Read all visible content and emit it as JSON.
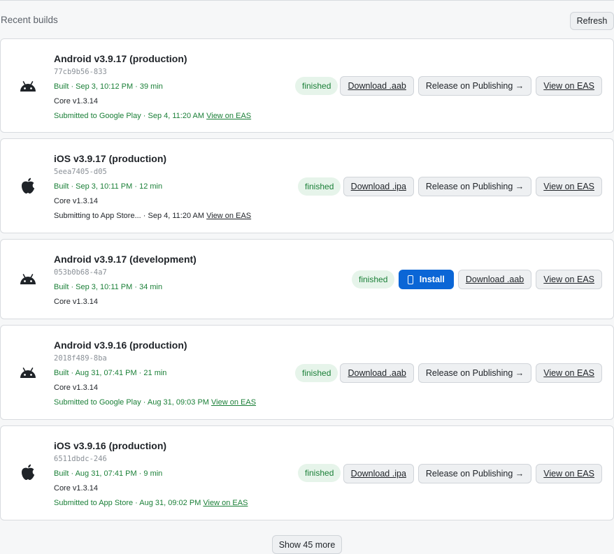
{
  "header": {
    "title": "Recent builds",
    "refresh_label": "Refresh"
  },
  "colors": {
    "success_green": "#1a7f37",
    "badge_bg": "#e6f4ea",
    "primary_blue": "#0b66d6"
  },
  "builds": [
    {
      "icon": "android-icon",
      "name": "Android v3.9.17 (production)",
      "hash": "77cb9b56-833",
      "built": "Built · Sep 3, 10:12 PM · 39 min",
      "core": "Core v1.3.14",
      "submission_text": "Submitted to Google Play · Sep 4, 11:20 AM",
      "submission_link": "View on EAS",
      "status": "finished",
      "download_label": "Download .aab",
      "release_label": "Release on Publishing →",
      "eas_label": "View on EAS"
    },
    {
      "icon": "apple-icon",
      "name": "iOS v3.9.17 (production)",
      "hash": "5eea7405-d05",
      "built": "Built · Sep 3, 10:11 PM · 12 min",
      "core": "Core v1.3.14",
      "submission_text": "Submitting to App Store... · Sep 4, 11:20 AM",
      "submission_link": "View on EAS",
      "status": "finished",
      "download_label": "Download .ipa",
      "release_label": "Release on Publishing →",
      "eas_label": "View on EAS"
    },
    {
      "icon": "android-icon",
      "name": "Android v3.9.17 (development)",
      "hash": "053b0b68-4a7",
      "built": "Built · Sep 3, 10:11 PM · 34 min",
      "core": "Core v1.3.14",
      "status": "finished",
      "install_label": "Install",
      "download_label": "Download .aab",
      "eas_label": "View on EAS"
    },
    {
      "icon": "android-icon",
      "name": "Android v3.9.16 (production)",
      "hash": "2018f489-8ba",
      "built": "Built · Aug 31, 07:41 PM · 21 min",
      "core": "Core v1.3.14",
      "submission_text": "Submitted to Google Play · Aug 31, 09:03 PM",
      "submission_link": "View on EAS",
      "status": "finished",
      "download_label": "Download .aab",
      "release_label": "Release on Publishing →",
      "eas_label": "View on EAS"
    },
    {
      "icon": "apple-icon",
      "name": "iOS v3.9.16 (production)",
      "hash": "6511dbdc-246",
      "built": "Built · Aug 31, 07:41 PM · 9 min",
      "core": "Core v1.3.14",
      "submission_text": "Submitted to App Store · Aug 31, 09:02 PM",
      "submission_link": "View on EAS",
      "status": "finished",
      "download_label": "Download .ipa",
      "release_label": "Release on Publishing →",
      "eas_label": "View on EAS"
    }
  ],
  "footer": {
    "show_more_label": "Show 45 more"
  }
}
